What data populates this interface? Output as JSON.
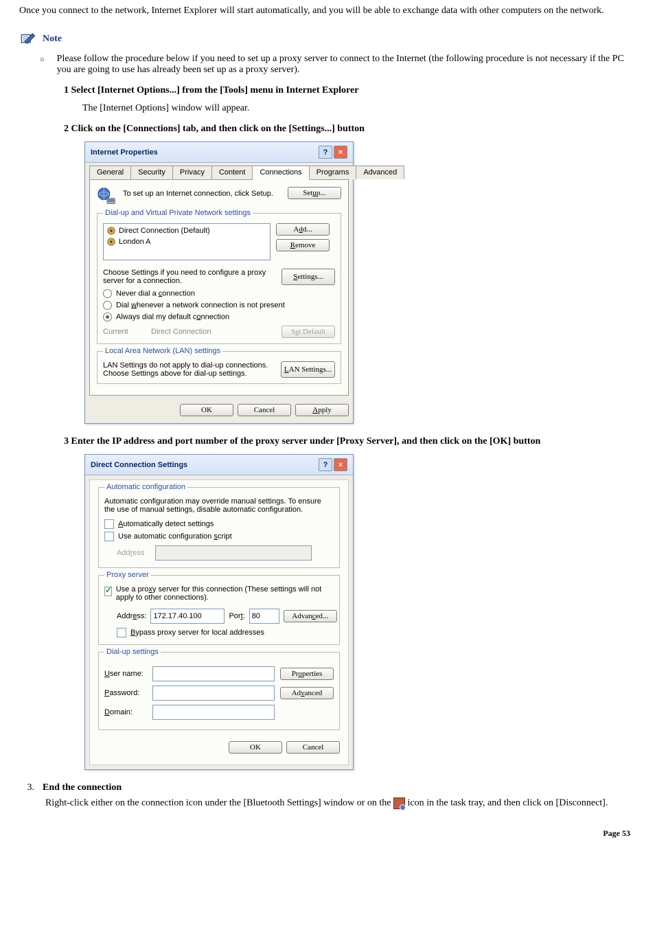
{
  "intro": "Once you connect to the network, Internet Explorer will start automatically, and you will be able to exchange data with other computers on the network.",
  "note_label": "Note",
  "note_text": "Please follow the procedure below if you need to set up a proxy server to connect to the Internet (the following procedure is not necessary if the PC you are going to use has already been set up as a proxy server).",
  "step1": {
    "title": "1 Select [Internet Options...] from the [Tools] menu in Internet Explorer",
    "desc": "The [Internet Options] window will appear."
  },
  "step2": {
    "title": "2 Click on the [Connections] tab, and then click on the [Settings...] button"
  },
  "ip_dialog": {
    "title": "Internet Properties",
    "tabs": [
      "General",
      "Security",
      "Privacy",
      "Content",
      "Connections",
      "Programs",
      "Advanced"
    ],
    "active_tab": "Connections",
    "setup_text": "To set up an Internet connection, click Setup.",
    "setup_btn": "Setup...",
    "dialup_legend": "Dial-up and Virtual Private Network settings",
    "connections": [
      "Direct Connection (Default)",
      "London A"
    ],
    "add_btn": "Add...",
    "remove_btn": "Remove",
    "choose_text": "Choose Settings if you need to configure a proxy server for a connection.",
    "settings_btn": "Settings...",
    "radio_never": "Never dial a connection",
    "radio_dialwhen": "Dial whenever a network connection is not present",
    "radio_always": "Always dial my default connection",
    "current_label": "Current",
    "current_value": "Direct Connection",
    "set_default_btn": "Set Default",
    "lan_legend": "Local Area Network (LAN) settings",
    "lan_text": "LAN Settings do not apply to dial-up connections. Choose Settings above for dial-up settings.",
    "lan_btn": "LAN Settings...",
    "ok": "OK",
    "cancel": "Cancel",
    "apply": "Apply"
  },
  "step3": {
    "title": "3 Enter the IP address and port number of the proxy server under [Proxy Server], and then click on the [OK] button"
  },
  "dcs_dialog": {
    "title": "Direct Connection Settings",
    "auto_legend": "Automatic configuration",
    "auto_text": "Automatic configuration may override manual settings.  To ensure the use of manual settings, disable automatic configuration.",
    "auto_detect": "Automatically detect settings",
    "use_script": "Use automatic configuration script",
    "address_label": "Address",
    "proxy_legend": "Proxy server",
    "use_proxy": "Use a proxy server for this connection (These settings will not apply to other connections).",
    "addr_label": "Address:",
    "addr_value": "172.17.40.100",
    "port_label": "Port:",
    "port_value": "80",
    "advanced_btn": "Advanced...",
    "bypass": "Bypass proxy server for local addresses",
    "dialup_legend": "Dial-up settings",
    "user_label": "User name:",
    "pass_label": "Password:",
    "domain_label": "Domain:",
    "properties_btn": "Properties",
    "advanced2_btn": "Advanced",
    "ok": "OK",
    "cancel": "Cancel"
  },
  "end": {
    "num": "3.",
    "title": "End the connection",
    "text_a": "Right-click either on the connection icon under the [Bluetooth Settings] window or on the",
    "text_b": "icon in the task tray, and then click on [Disconnect]."
  },
  "page_label": "Page 53"
}
